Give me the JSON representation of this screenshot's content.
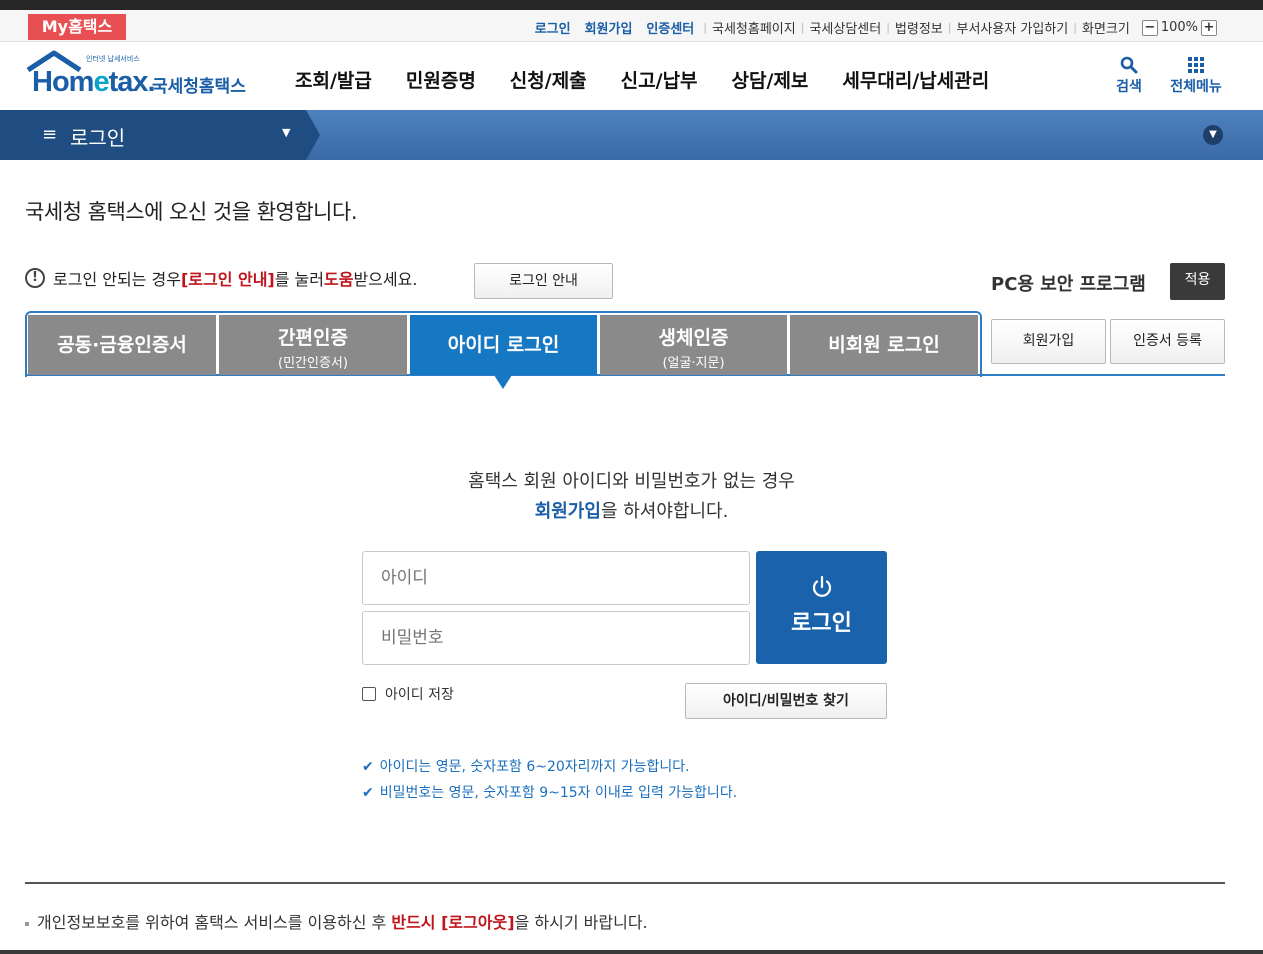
{
  "util": {
    "my_hometax": "My홈택스",
    "login": "로그인",
    "signup": "회원가입",
    "cert_center": "인증센터",
    "links": [
      "국세청홈페이지",
      "국세상담센터",
      "법령정보",
      "부서사용자 가입하기",
      "화면크기"
    ],
    "zoom_minus": "−",
    "zoom_value": "100%",
    "zoom_plus": "+"
  },
  "logo": {
    "tiny": "인터넷 납세서비스",
    "home_a": "Hom",
    "home_e": "e",
    "home_b": "tax.",
    "kor": "국세청홈택스"
  },
  "gnb": [
    "조회/발급",
    "민원증명",
    "신청/제출",
    "신고/납부",
    "상담/제보",
    "세무대리/납세관리"
  ],
  "header_icons": {
    "search": "검색",
    "all_menu": "전체메뉴"
  },
  "breadcrumb": {
    "label": "로그인"
  },
  "welcome": "국세청 홈택스에 오신 것을 환영합니다.",
  "notice": {
    "pre": "로그인 안되는 경우 ",
    "link1": "[로그인 안내]",
    "mid": "를 눌러 ",
    "link2": "도움",
    "post": "받으세요.",
    "guide_button": "로그인 안내"
  },
  "security": {
    "label": "PC용 보안 프로그램",
    "apply": "적용"
  },
  "tabs": [
    {
      "label": "공동·금융인증서",
      "sub": ""
    },
    {
      "label": "간편인증",
      "sub": "(민간인증서)"
    },
    {
      "label": "아이디 로그인",
      "sub": ""
    },
    {
      "label": "생체인증",
      "sub": "(얼굴·지문)"
    },
    {
      "label": "비회원 로그인",
      "sub": ""
    }
  ],
  "active_tab": 2,
  "side_buttons": {
    "signup": "회원가입",
    "cert_register": "인증서 등록"
  },
  "info": {
    "line1": "홈택스 회원 아이디와 비밀번호가 없는 경우",
    "link": "회원가입",
    "line2_post": "을 하셔야합니다."
  },
  "form": {
    "id_placeholder": "아이디",
    "pw_placeholder": "비밀번호",
    "login_button": "로그인",
    "save_id": "아이디 저장",
    "find_button": "아이디/비밀번호 찾기"
  },
  "tips": [
    "아이디는 영문, 숫자포함 6~20자리까지 가능합니다.",
    "비밀번호는 영문, 숫자포함 9~15자 이내로 입력 가능합니다."
  ],
  "footer": {
    "pre": "개인정보보호를 위하여 홈택스 서비스를 이용하신 후 ",
    "red": "반드시 [로그아웃]",
    "post": "을 하시기 바랍니다."
  },
  "colors": {
    "brand": "#1a5ea8",
    "tab_active": "#1677c2",
    "tab_inactive": "#8a8a8a",
    "alert": "#c0141b",
    "my_badge": "#e84f52"
  }
}
